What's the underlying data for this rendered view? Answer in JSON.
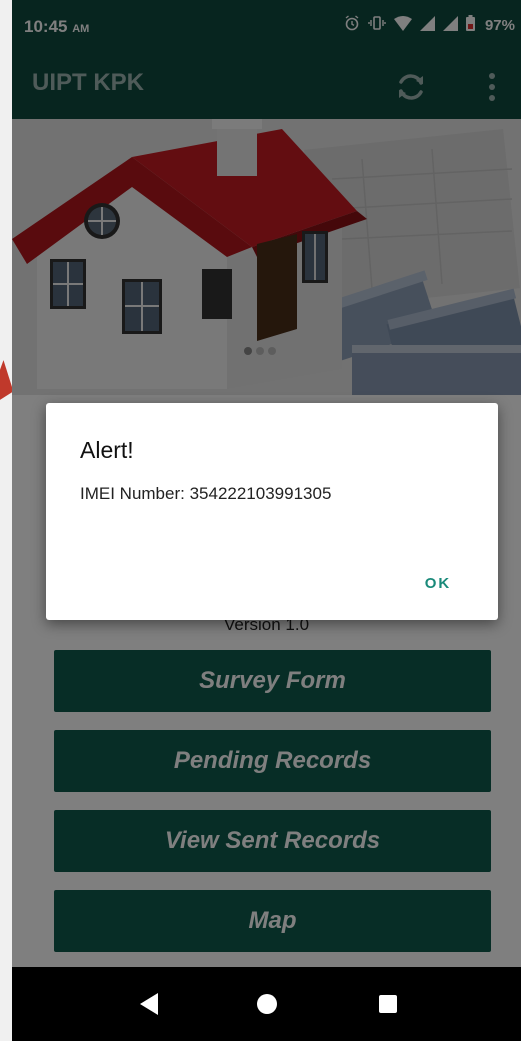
{
  "status_bar": {
    "time": "10:45",
    "time_suffix": "AM",
    "battery": "97%",
    "icons": [
      "alarm-icon",
      "vibrate-icon",
      "wifi-icon",
      "signal-icon",
      "signal-icon",
      "battery-icon"
    ]
  },
  "app_bar": {
    "title": "UIPT KPK",
    "icons": [
      "refresh-icon",
      "overflow-menu-icon"
    ]
  },
  "banner": {
    "image": "house-and-money-illustration",
    "carousel_dots": 3
  },
  "main": {
    "version": "Version 1.0",
    "buttons": [
      {
        "label": "Survey Form"
      },
      {
        "label": "Pending Records"
      },
      {
        "label": "View Sent Records"
      },
      {
        "label": "Map"
      }
    ]
  },
  "dialog": {
    "title": "Alert!",
    "message": "IMEI Number: 354222103991305",
    "ok_label": "OK"
  },
  "nav_bar": {
    "icons": [
      "back-icon",
      "home-icon",
      "recents-icon"
    ]
  },
  "colors": {
    "primary_dark": "#0f4a3f",
    "button": "#0f5b4c",
    "accent": "#1a8a7a"
  }
}
